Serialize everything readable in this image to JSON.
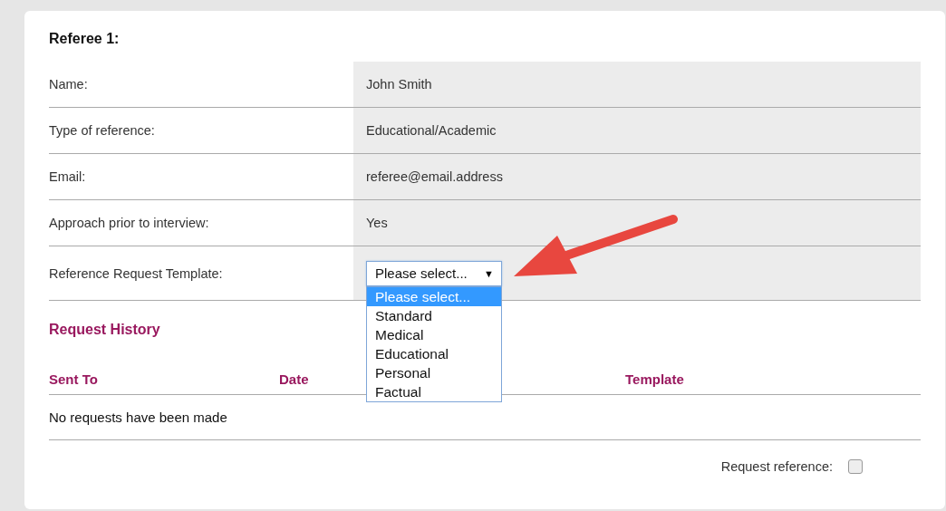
{
  "title": "Referee 1:",
  "details": [
    {
      "label": "Name:",
      "value": "John Smith"
    },
    {
      "label": "Type of reference:",
      "value": "Educational/Academic"
    },
    {
      "label": "Email:",
      "value": "referee@email.address"
    },
    {
      "label": "Approach prior to interview:",
      "value": "Yes"
    }
  ],
  "template": {
    "label": "Reference Request Template:",
    "value": "Please select...",
    "caret": "▼",
    "expanded": true,
    "options": [
      {
        "label": "Please select...",
        "selected": true
      },
      {
        "label": "Standard",
        "selected": false
      },
      {
        "label": "Medical",
        "selected": false
      },
      {
        "label": "Educational",
        "selected": false
      },
      {
        "label": "Personal",
        "selected": false
      },
      {
        "label": "Factual",
        "selected": false
      }
    ]
  },
  "history": {
    "title": "Request History",
    "columns": [
      "Sent To",
      "Date",
      "Template"
    ],
    "empty_message": "No requests have been made"
  },
  "request_reference": {
    "label": "Request reference:",
    "checked": false
  }
}
